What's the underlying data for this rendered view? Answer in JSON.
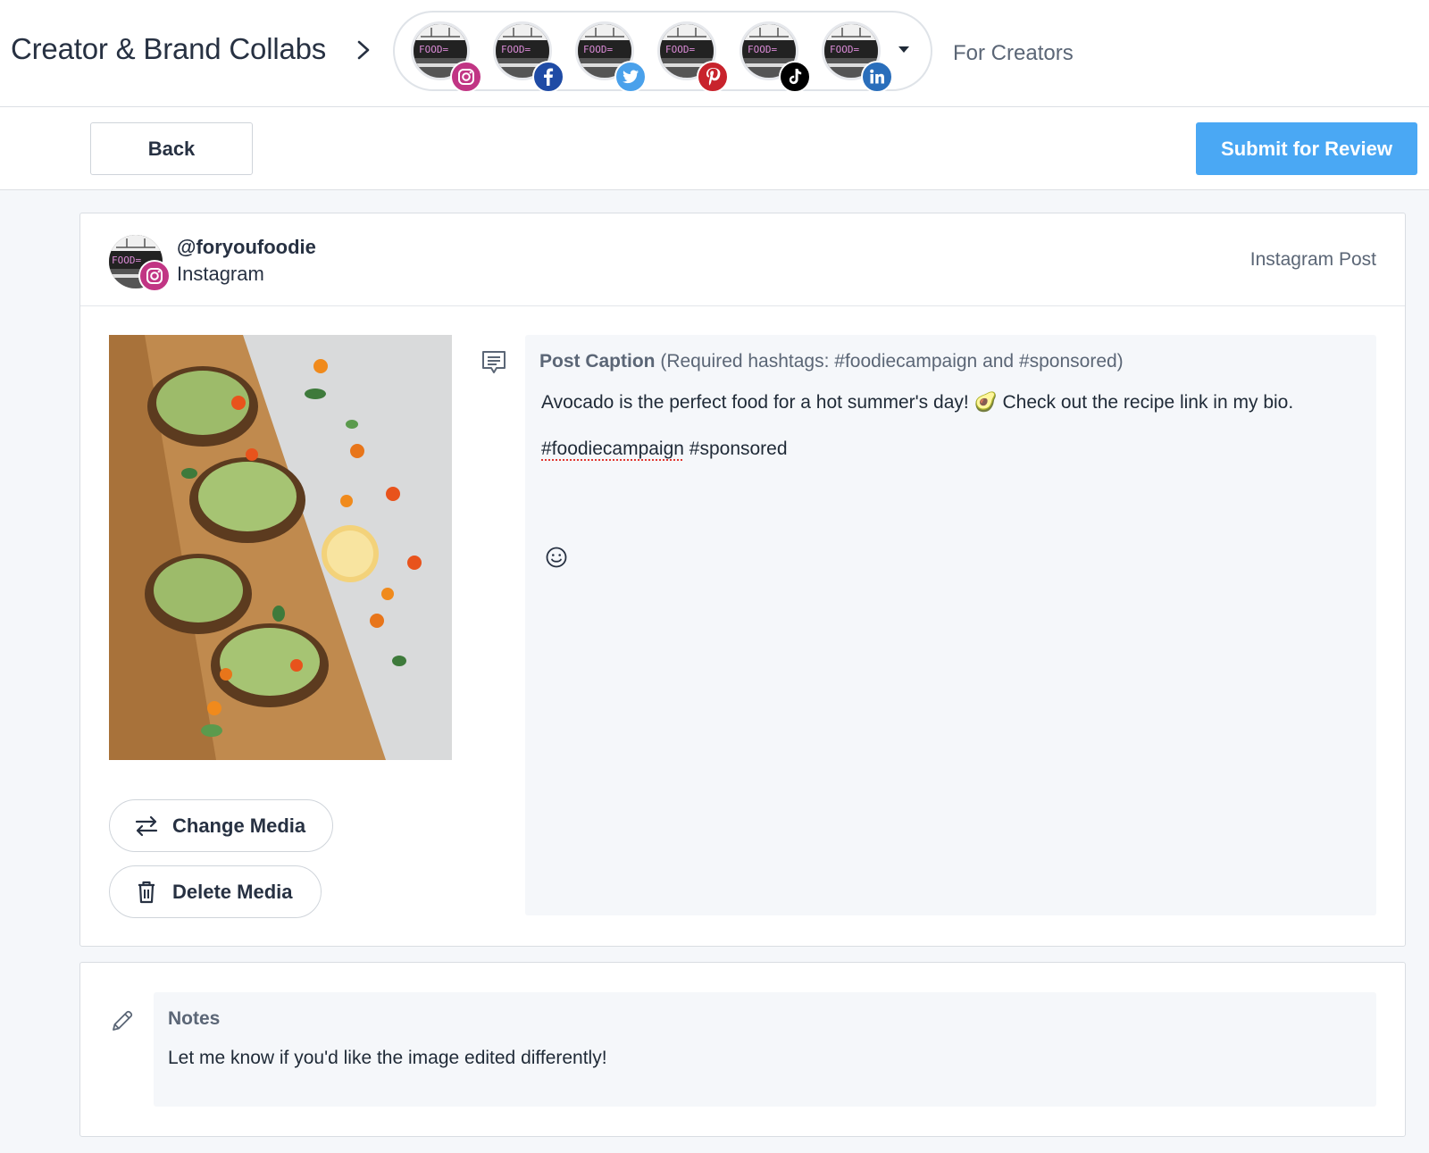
{
  "header": {
    "app_title": "Creator & Brand Collabs",
    "account_thumb_text": "FOOD=",
    "accounts": [
      {
        "network": "Instagram",
        "icon": "instagram-icon",
        "color": "#c13584"
      },
      {
        "network": "Facebook",
        "icon": "facebook-icon",
        "color": "#1f4ba5"
      },
      {
        "network": "Twitter",
        "icon": "twitter-icon",
        "color": "#4aa1eb"
      },
      {
        "network": "Pinterest",
        "icon": "pinterest-icon",
        "color": "#c8232c"
      },
      {
        "network": "TikTok",
        "icon": "tiktok-icon",
        "color": "#000000"
      },
      {
        "network": "LinkedIn",
        "icon": "linkedin-icon",
        "color": "#2a6ebb"
      }
    ],
    "section_label": "For Creators"
  },
  "actions": {
    "back_label": "Back",
    "submit_label": "Submit for Review",
    "submit_color": "#4aa8f4"
  },
  "post": {
    "handle": "@foryoufoodie",
    "network": "Instagram",
    "post_type": "Instagram Post",
    "change_media_label": "Change Media",
    "delete_media_label": "Delete Media",
    "caption_label_bold": "Post Caption",
    "caption_label_rest": " (Required hashtags: #foodiecampaign and #sponsored)",
    "caption_text": "Avocado is the perfect food for a hot summer's day! 🥑 Check out the recipe link in my bio.",
    "caption_tag_1": "#foodiecampaign",
    "caption_tag_2": " #sponsored"
  },
  "notes": {
    "label": "Notes",
    "text": "Let me know if you'd like the image edited differently!"
  }
}
